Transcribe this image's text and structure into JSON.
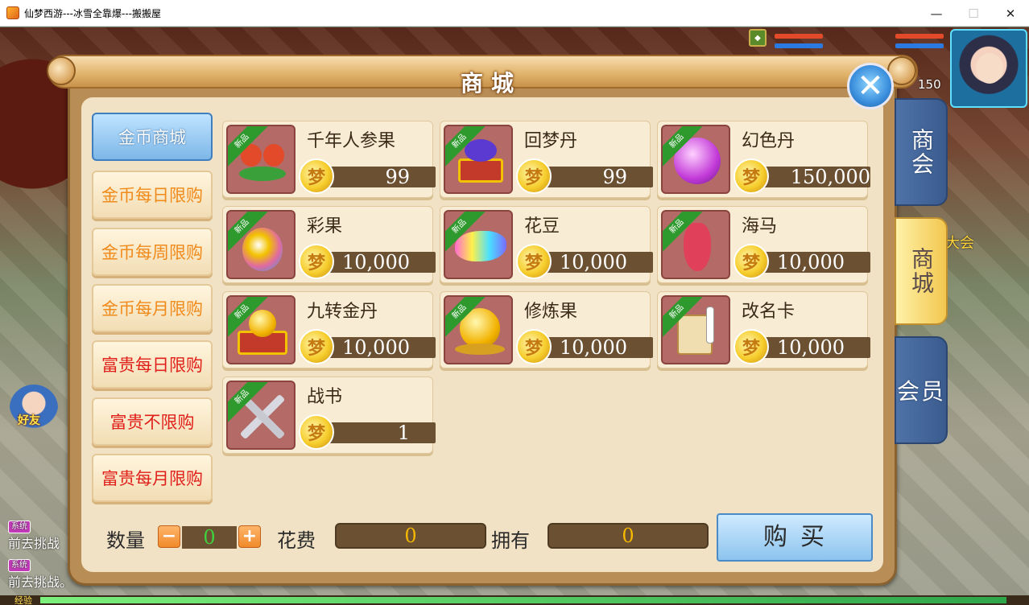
{
  "window": {
    "title": "仙梦西游---冰雪全靠爆---搬搬屋",
    "minimize": "—",
    "maximize": "☐",
    "close": "✕"
  },
  "hud": {
    "level": "150",
    "friend_label": "好友",
    "side_text": "大会",
    "exp_label": "经验",
    "chat": [
      {
        "tag": "系统",
        "text": "前去挑战"
      },
      {
        "tag": "系统",
        "text": "前去挑战。"
      }
    ]
  },
  "shop": {
    "title": "商城",
    "close_label": "✕",
    "side_tabs": [
      {
        "label": "商会"
      },
      {
        "label": "商城"
      },
      {
        "label": "会员"
      }
    ],
    "categories": [
      {
        "label": "金币商城"
      },
      {
        "label": "金币每日限购"
      },
      {
        "label": "金币每周限购"
      },
      {
        "label": "金币每月限购"
      },
      {
        "label": "富贵每日限购"
      },
      {
        "label": "富贵不限购"
      },
      {
        "label": "富贵每月限购"
      }
    ],
    "new_badge": "新品",
    "coin_glyph": "梦",
    "items": [
      {
        "name": "千年人参果",
        "price": "99",
        "icon": "ginseng-fruit-icon"
      },
      {
        "name": "回梦丹",
        "price": "99",
        "icon": "treasure-chest-icon"
      },
      {
        "name": "幻色丹",
        "price": "150,000",
        "icon": "purple-orb-icon"
      },
      {
        "name": "彩果",
        "price": "10,000",
        "icon": "rainbow-fruit-icon"
      },
      {
        "name": "花豆",
        "price": "10,000",
        "icon": "rainbow-bean-icon"
      },
      {
        "name": "海马",
        "price": "10,000",
        "icon": "seahorse-icon"
      },
      {
        "name": "九转金丹",
        "price": "10,000",
        "icon": "golden-pill-chest-icon"
      },
      {
        "name": "修炼果",
        "price": "10,000",
        "icon": "golden-orb-icon"
      },
      {
        "name": "改名卡",
        "price": "10,000",
        "icon": "scroll-quill-icon"
      },
      {
        "name": "战书",
        "price": "1",
        "icon": "crossed-swords-icon"
      }
    ],
    "footer": {
      "qty_label": "数量",
      "minus": "−",
      "plus": "+",
      "qty_value": "0",
      "cost_label": "花费",
      "cost_value": "0",
      "owned_label": "拥有",
      "owned_value": "0",
      "buy_label": "购买"
    }
  },
  "colors": {
    "panel": "#f1e2c5",
    "selected_category": "#7db7e8",
    "orange_text": "#f08a1a",
    "red_text": "#e0201a",
    "price_bg": "#6b5132",
    "new_ribbon": "#2e9a2e"
  }
}
